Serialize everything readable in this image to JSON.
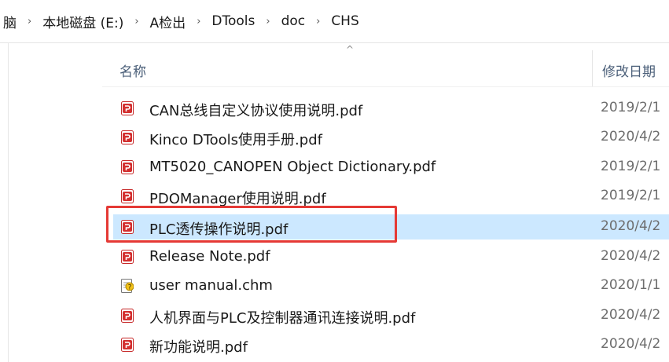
{
  "breadcrumb": [
    {
      "label": "脑"
    },
    {
      "label": "本地磁盘 (E:)"
    },
    {
      "label": "A检出"
    },
    {
      "label": "DTools"
    },
    {
      "label": "doc"
    },
    {
      "label": "CHS"
    }
  ],
  "breadcrumb_separator": "›",
  "columns": {
    "name": "名称",
    "sort_indicator": "^",
    "date_modified": "修改日期"
  },
  "files": [
    {
      "name": "CAN总线自定义协议使用说明.pdf",
      "date": "2019/2/1",
      "icon": "pdf-file-icon"
    },
    {
      "name": "Kinco DTools使用手册.pdf",
      "date": "2020/4/2",
      "icon": "pdf-file-icon"
    },
    {
      "name": "MT5020_CANOPEN Object Dictionary.pdf",
      "date": "2019/2/1",
      "icon": "pdf-file-icon"
    },
    {
      "name": "PDOManager使用说明.pdf",
      "date": "2019/2/1",
      "icon": "pdf-file-icon"
    },
    {
      "name": "PLC透传操作说明.pdf",
      "date": "2020/4/2",
      "icon": "pdf-file-icon",
      "selected": true
    },
    {
      "name": "Release Note.pdf",
      "date": "2020/4/2",
      "icon": "pdf-file-icon"
    },
    {
      "name": "user manual.chm",
      "date": "2020/1/1",
      "icon": "chm-help-file-icon"
    },
    {
      "name": "人机界面与PLC及控制器通讯连接说明.pdf",
      "date": "2020/4/2",
      "icon": "pdf-file-icon"
    },
    {
      "name": "新功能说明.pdf",
      "date": "2020/4/2",
      "icon": "pdf-file-icon"
    }
  ],
  "colors": {
    "selection": "#cce8ff",
    "highlight_border": "#e53935",
    "pdf_icon": "#d32f2f",
    "column_header_text": "#4c607a"
  }
}
